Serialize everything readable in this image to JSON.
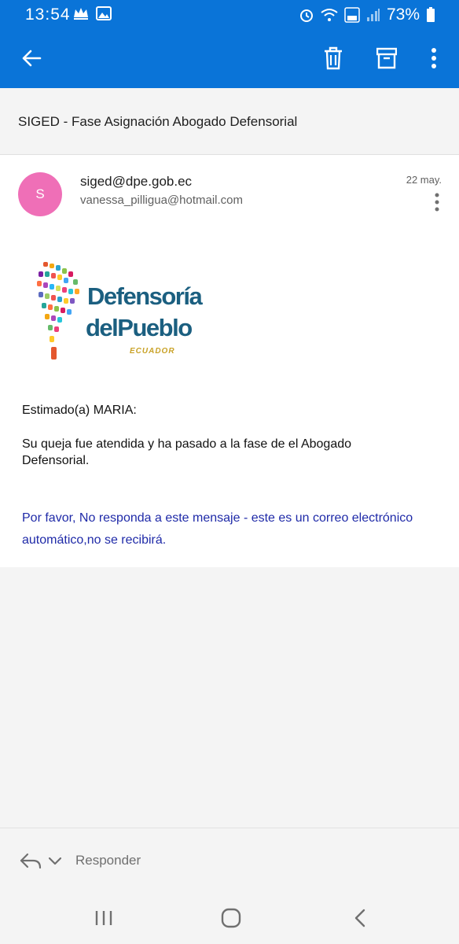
{
  "status_bar": {
    "time": "13:54",
    "battery": "73%"
  },
  "subject": "SIGED - Fase Asignación Abogado Defensorial",
  "message": {
    "avatar_letter": "S",
    "avatar_color": "#ef6fb7",
    "from": "siged@dpe.gob.ec",
    "to": "vanessa_pilligua@hotmail.com",
    "date": "22 may.",
    "logo": {
      "line1": "Defensoría",
      "line2": "delPueblo",
      "line3": "ECUADOR"
    },
    "greeting": "Estimado(a) MARIA:",
    "body": "Su queja fue atendida y ha pasado a la fase de el Abogado Defensorial.",
    "notice": "Por favor, No responda a este mensaje - este es un correo electrónico automático,no se recibirá."
  },
  "reply": {
    "label": "Responder"
  },
  "colors": {
    "appbar": "#0a74d8",
    "notice_text": "#1f2aa8"
  }
}
